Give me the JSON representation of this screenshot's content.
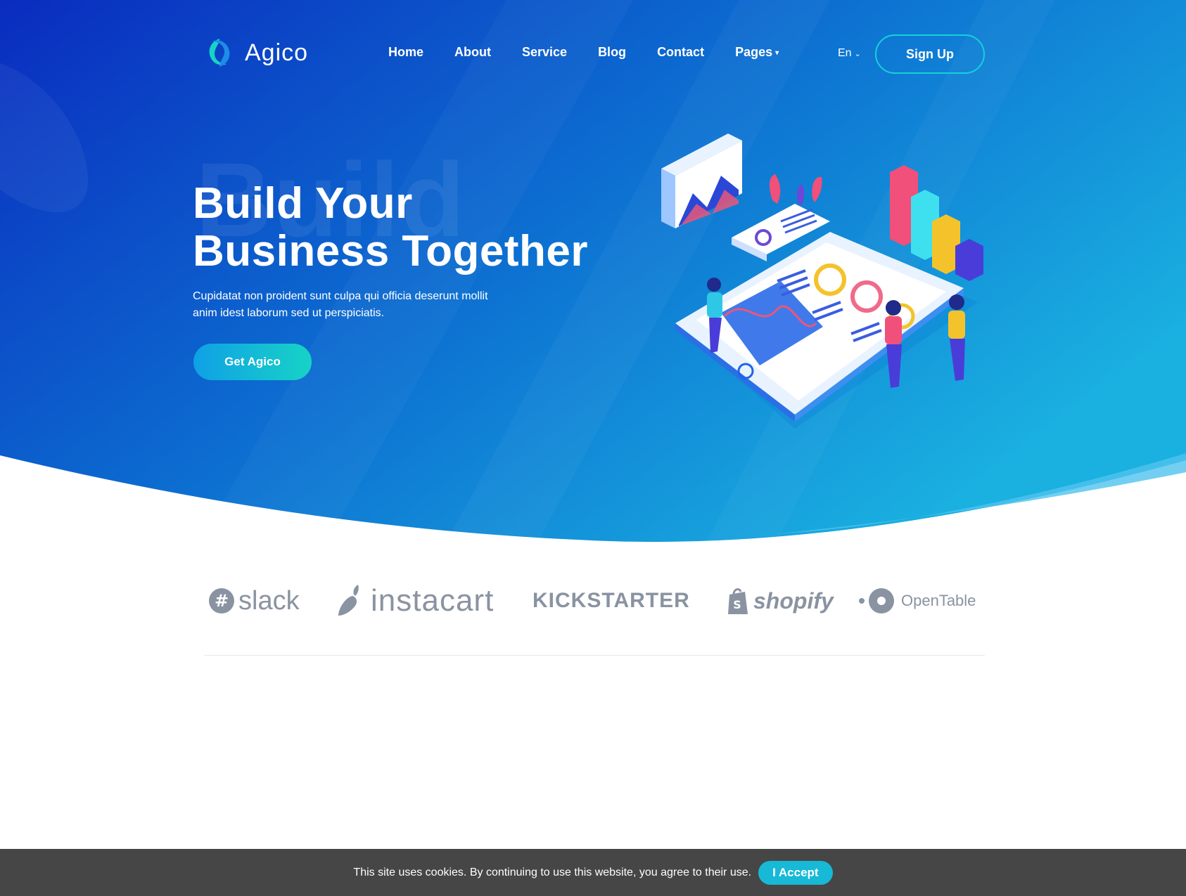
{
  "brand": {
    "logo_text": "Agico",
    "accent_color": "#16d1d9",
    "hero_gradient": [
      "#0a2fc2",
      "#1aa7de"
    ]
  },
  "nav": {
    "items": [
      {
        "label": "Home"
      },
      {
        "label": "About"
      },
      {
        "label": "Service"
      },
      {
        "label": "Blog"
      },
      {
        "label": "Contact"
      },
      {
        "label": "Pages",
        "has_dropdown": true
      }
    ],
    "language": "En",
    "signup_label": "Sign Up"
  },
  "hero": {
    "watermark": "Build",
    "title_line1": "Build Your",
    "title_line2": "Business Together",
    "subtitle_line1": "Cupidatat non proident sunt culpa qui officia deserunt mollit",
    "subtitle_line2": "anim idest laborum sed ut perspiciatis.",
    "cta_label": "Get Agico"
  },
  "partners": [
    {
      "name": "slack",
      "icon": "slack-logo"
    },
    {
      "name": "instacart",
      "icon": "carrot-logo"
    },
    {
      "name": "KICKSTARTER",
      "icon": "kickstarter-wordmark"
    },
    {
      "name": "shopify",
      "icon": "shopify-bag-logo"
    },
    {
      "name": "OpenTable",
      "icon": "opentable-dot-logo"
    }
  ],
  "cookie": {
    "message": "This site uses cookies. By continuing to use this website, you agree to their use.",
    "accept_label": "I Accept"
  }
}
